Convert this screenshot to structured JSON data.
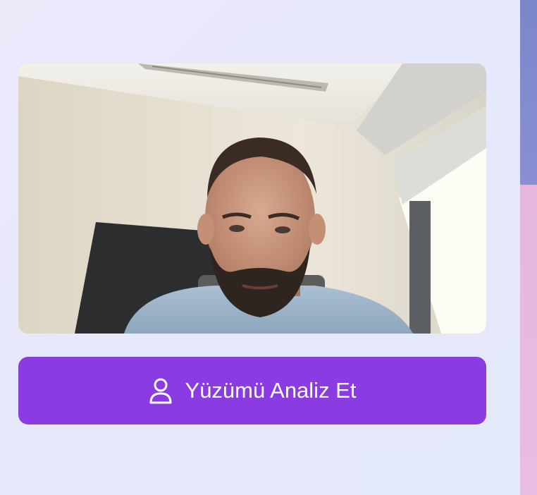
{
  "camera": {
    "icon": "camera-feed"
  },
  "analyze_button": {
    "label": "Yüzümü Analiz Et",
    "icon": "person-icon",
    "color": "#8a3be1"
  },
  "colors": {
    "background": "#e8e8fb",
    "side_strip_top": "#7b86c9",
    "side_strip_bottom": "#e6b6e0"
  }
}
